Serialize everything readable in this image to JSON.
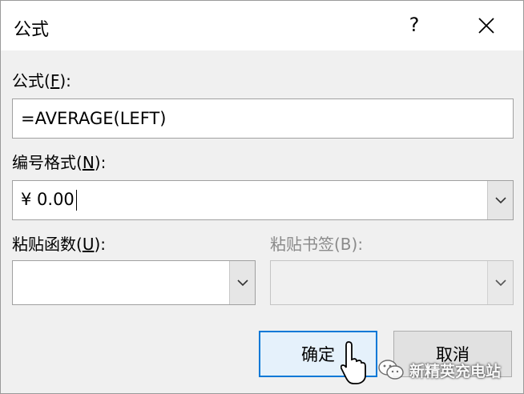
{
  "dialog": {
    "title": "公式",
    "help_label": "?",
    "close_label": "✕"
  },
  "formula": {
    "label_prefix": "公式(",
    "label_key": "F",
    "label_suffix": "):",
    "value": "=AVERAGE(LEFT)"
  },
  "number_format": {
    "label_prefix": "编号格式(",
    "label_key": "N",
    "label_suffix": "):",
    "value": "¥ 0.00"
  },
  "paste_function": {
    "label_prefix": "粘贴函数(",
    "label_key": "U",
    "label_suffix": "):",
    "value": ""
  },
  "paste_bookmark": {
    "label": "粘贴书签(B):",
    "value": "",
    "disabled": true
  },
  "buttons": {
    "ok": "确定",
    "cancel": "取消"
  },
  "watermark": {
    "text": "新精英充电站"
  },
  "colors": {
    "accent": "#0078d7",
    "dialog_bg": "#f0f0f0",
    "disabled_text": "#8a8a8a"
  }
}
